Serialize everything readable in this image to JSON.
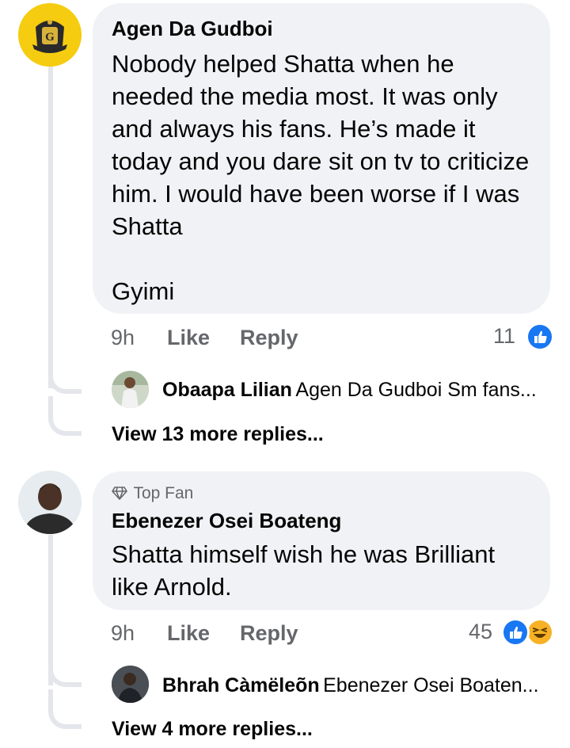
{
  "comments": [
    {
      "author": "Agen Da Gudboi",
      "text": "Nobody helped Shatta when he needed the media most. It was only and always his fans. He’s made it today and you dare sit on tv to criticize him. I would have been worse if I was Shatta\n\nGyimi",
      "time": "9h",
      "like_label": "Like",
      "reply_label": "Reply",
      "reaction_count": "11",
      "reactions": [
        "like-icon"
      ],
      "reply_preview": {
        "author": "Obaapa Lilian",
        "text": "Agen Da Gudboi Sm fans..."
      },
      "view_more": "View 13 more replies..."
    },
    {
      "badge": "Top Fan",
      "badge_icon": "diamond-icon",
      "author": "Ebenezer Osei Boateng",
      "text": "Shatta himself wish he was Brilliant like Arnold.",
      "time": "9h",
      "like_label": "Like",
      "reply_label": "Reply",
      "reaction_count": "45",
      "reactions": [
        "like-icon",
        "haha-icon"
      ],
      "reply_preview": {
        "author": "Bhrah Càmëleõn",
        "text": "Ebenezer Osei Boaten..."
      },
      "view_more": "View 4 more replies..."
    }
  ],
  "colors": {
    "bubble": "#f0f2f5",
    "meta": "#65676b",
    "like_blue": "#1877f2",
    "haha_yellow": "#f7b125",
    "thread_line": "#e4e6eb"
  }
}
